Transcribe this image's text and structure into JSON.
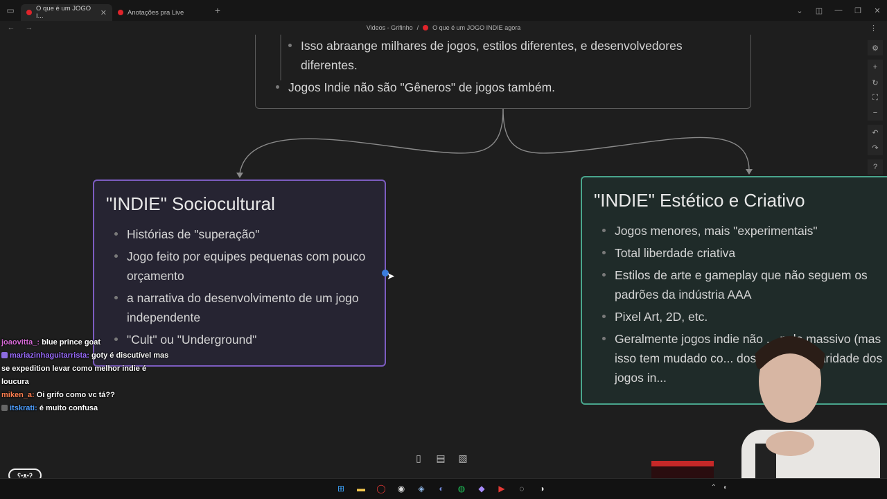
{
  "browser": {
    "tabs": [
      {
        "label": "O que é um JOGO I...",
        "active": true
      },
      {
        "label": "Anotações pra Live",
        "active": false
      }
    ],
    "breadcrumb": {
      "parent": "Videos - Grifinho",
      "separator": "/",
      "current": "O que é um JOGO INDIE agora"
    }
  },
  "top_card": {
    "items": [
      "Isso abraange milhares de jogos, estilos diferentes, e desenvolvedores",
      "diferentes.",
      "Jogos Indie não são \"Gêneros\" de jogos também."
    ]
  },
  "card_socio": {
    "title": "\"INDIE\" Sociocultural",
    "items": [
      "Histórias de \"superação\"",
      "Jogo feito por equipes pequenas com pouco orçamento",
      "a narrativa do desenvolvimento de um jogo independente",
      "\"Cult\" ou \"Underground\""
    ]
  },
  "card_estet": {
    "title": "\"INDIE\" Estético e Criativo",
    "items": [
      "Jogos menores, mais \"experimentais\"",
      "Total liberdade criativa",
      "Estilos de arte e gameplay que não seguem os padrões da indústria AAA",
      "Pixel Art, 2D, etc.",
      "Geralmente jogos indie não ... pelo massivo (mas isso tem mudado co... dos anos popularidade dos jogos in..."
    ]
  },
  "chat": [
    {
      "user": "joaovitta_",
      "message": "blue prince goat"
    },
    {
      "user": "mariazinhaguitarrista",
      "message": "goty é discutível mas se expedition levar como melhor indie é loucura"
    },
    {
      "user": "miken_a",
      "message": "Oi grifo como vc tá??"
    },
    {
      "user": "itskrati",
      "message": "é muito confusa"
    }
  ],
  "colors": {
    "socio_border": "#7c5cc0",
    "estet_border": "#49a58c",
    "tab_dot": "#e0242b"
  }
}
